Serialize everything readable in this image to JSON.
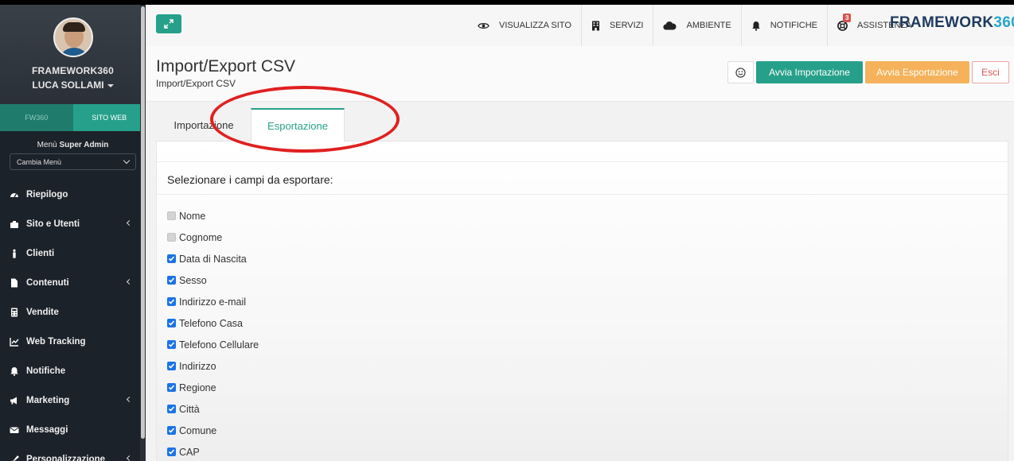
{
  "sidebar": {
    "org_name": "FRAMEWORK360",
    "user_name": "LUCA SOLLAMI",
    "switch": {
      "fw": "FW360",
      "web": "SITO WEB"
    },
    "menu_title_prefix": "Menù",
    "menu_title_bold": "Super Admin",
    "menu_select": "Cambia Menù",
    "items": [
      {
        "label": "Riepilogo",
        "icon": "dashboard-icon",
        "arrow": false
      },
      {
        "label": "Sito e Utenti",
        "icon": "users-icon",
        "arrow": true
      },
      {
        "label": "Clienti",
        "icon": "person-icon",
        "arrow": false
      },
      {
        "label": "Contenuti",
        "icon": "file-icon",
        "arrow": true
      },
      {
        "label": "Vendite",
        "icon": "calculator-icon",
        "arrow": false
      },
      {
        "label": "Web Tracking",
        "icon": "chart-icon",
        "arrow": false
      },
      {
        "label": "Notifiche",
        "icon": "bell-icon",
        "arrow": false
      },
      {
        "label": "Marketing",
        "icon": "megaphone-icon",
        "arrow": true
      },
      {
        "label": "Messaggi",
        "icon": "envelope-icon",
        "arrow": false
      },
      {
        "label": "Personalizzazione",
        "icon": "brush-icon",
        "arrow": true
      }
    ]
  },
  "topbar": {
    "links": [
      {
        "label": "VISUALIZZA SITO",
        "icon": "eye-icon"
      },
      {
        "label": "SERVIZI",
        "icon": "building-icon"
      },
      {
        "label": "AMBIENTE",
        "icon": "cloud-icon"
      },
      {
        "label": "NOTIFICHE",
        "icon": "bell-icon"
      },
      {
        "label": "ASSISTENZA",
        "icon": "lifebuoy-icon",
        "badge": "3"
      }
    ],
    "brand_main": "FRAMEWORK",
    "brand_num": "360"
  },
  "header": {
    "title": "Import/Export CSV",
    "breadcrumb": "Import/Export CSV",
    "buttons": {
      "import": "Avvia Importazione",
      "export": "Avvia Esportazione",
      "exit": "Esci"
    }
  },
  "tabs": {
    "import": "Importazione",
    "export": "Esportazione"
  },
  "panel": {
    "label": "Selezionare i campi da esportare:",
    "fields": [
      {
        "label": "Nome",
        "state": "disabled"
      },
      {
        "label": "Cognome",
        "state": "disabled"
      },
      {
        "label": "Data di Nascita",
        "state": "checked"
      },
      {
        "label": "Sesso",
        "state": "checked"
      },
      {
        "label": "Indirizzo e-mail",
        "state": "checked"
      },
      {
        "label": "Telefono Casa",
        "state": "checked"
      },
      {
        "label": "Telefono Cellulare",
        "state": "checked"
      },
      {
        "label": "Indirizzo",
        "state": "checked"
      },
      {
        "label": "Regione",
        "state": "checked"
      },
      {
        "label": "Città",
        "state": "checked"
      },
      {
        "label": "Comune",
        "state": "checked"
      },
      {
        "label": "CAP",
        "state": "checked"
      }
    ]
  },
  "colors": {
    "accent": "#26a08a",
    "sidebar_bg": "#1c2229",
    "export_btn": "#f5b25a",
    "exit_btn": "#d9534f",
    "highlight": "#e02020"
  }
}
